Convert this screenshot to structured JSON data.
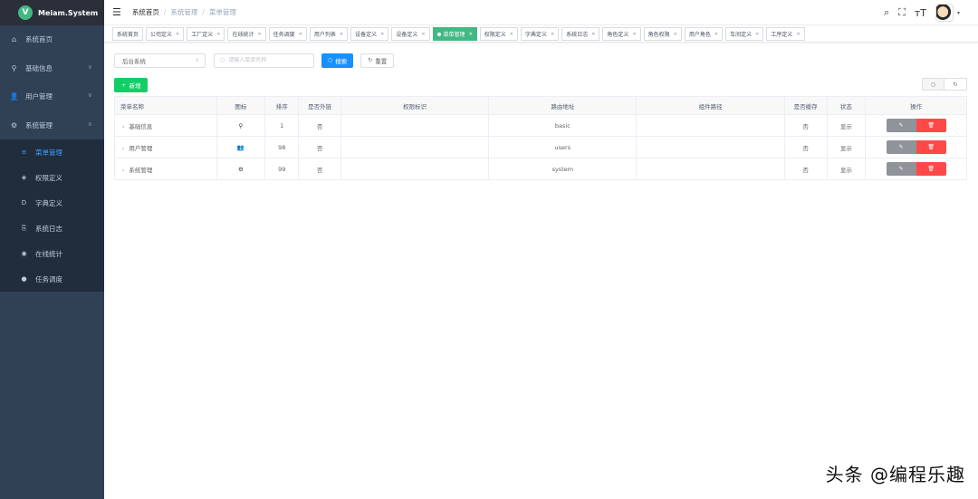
{
  "app": {
    "logo_letter": "V",
    "title": "Meiam.System"
  },
  "sidebar": {
    "items": [
      {
        "icon": "dashboard-icon",
        "glyph": "⌂",
        "label": "系统首页",
        "chevron": ""
      },
      {
        "icon": "org-tree-icon",
        "glyph": "⚲",
        "label": "基础信息",
        "chevron": "∨"
      },
      {
        "icon": "user-icon",
        "glyph": "👤",
        "label": "用户管理",
        "chevron": "∨"
      },
      {
        "icon": "gear-icon",
        "glyph": "⚙",
        "label": "系统管理",
        "chevron": "∧"
      }
    ],
    "sub_items": [
      {
        "icon": "list-icon",
        "glyph": "≡",
        "label": "菜单管理",
        "active": true
      },
      {
        "icon": "shield-icon",
        "glyph": "◈",
        "label": "权限定义"
      },
      {
        "icon": "dict-icon",
        "glyph": "D",
        "label": "字典定义"
      },
      {
        "icon": "log-icon",
        "glyph": "⎘",
        "label": "系统日志"
      },
      {
        "icon": "globe-icon",
        "glyph": "◉",
        "label": "在线统计"
      },
      {
        "icon": "clock-icon",
        "glyph": "●",
        "label": "任务调度"
      }
    ]
  },
  "navbar": {
    "breadcrumb": [
      "系统首页",
      "系统管理",
      "菜单管理"
    ],
    "separator": "/"
  },
  "tags": [
    {
      "label": "系统首页",
      "closable": false
    },
    {
      "label": "公司定义",
      "closable": true
    },
    {
      "label": "工厂定义",
      "closable": true
    },
    {
      "label": "在线统计",
      "closable": true
    },
    {
      "label": "任务调度",
      "closable": true
    },
    {
      "label": "用户列表",
      "closable": true
    },
    {
      "label": "设备定义",
      "closable": true
    },
    {
      "label": "设备定义",
      "closable": true
    },
    {
      "label": "菜单管理",
      "closable": true,
      "active": true
    },
    {
      "label": "权限定义",
      "closable": true
    },
    {
      "label": "字典定义",
      "closable": true
    },
    {
      "label": "系统日志",
      "closable": true
    },
    {
      "label": "角色定义",
      "closable": true
    },
    {
      "label": "角色权限",
      "closable": true
    },
    {
      "label": "用户角色",
      "closable": true
    },
    {
      "label": "车间定义",
      "closable": true
    },
    {
      "label": "工序定义",
      "closable": true
    }
  ],
  "search": {
    "system_select": "后台系统",
    "placeholder": "请输入菜单名称",
    "search_label": "搜索",
    "reset_label": "重置",
    "add_label": "新增"
  },
  "table": {
    "columns": [
      "菜单名称",
      "图标",
      "排序",
      "是否外链",
      "权限标识",
      "路由地址",
      "组件路径",
      "是否缓存",
      "状态",
      "操作"
    ],
    "rows": [
      {
        "name": "基础信息",
        "icon": "org-tree-icon",
        "glyph": "⚲",
        "sort": "1",
        "external": "否",
        "perm": "",
        "route": "basic",
        "component": "",
        "cache": "否",
        "status": "显示"
      },
      {
        "name": "用户管理",
        "icon": "user-icon",
        "glyph": "👥",
        "sort": "98",
        "external": "否",
        "perm": "",
        "route": "users",
        "component": "",
        "cache": "否",
        "status": "显示"
      },
      {
        "name": "系统管理",
        "icon": "gear-icon",
        "glyph": "⚙",
        "sort": "99",
        "external": "否",
        "perm": "",
        "route": "system",
        "component": "",
        "cache": "否",
        "status": "显示"
      }
    ]
  },
  "watermark": "头条 @编程乐趣",
  "colors": {
    "sidebar_bg": "#304156",
    "active_tag": "#42b983",
    "primary": "#1890ff",
    "success": "#13ce66",
    "danger": "#ff4949"
  }
}
